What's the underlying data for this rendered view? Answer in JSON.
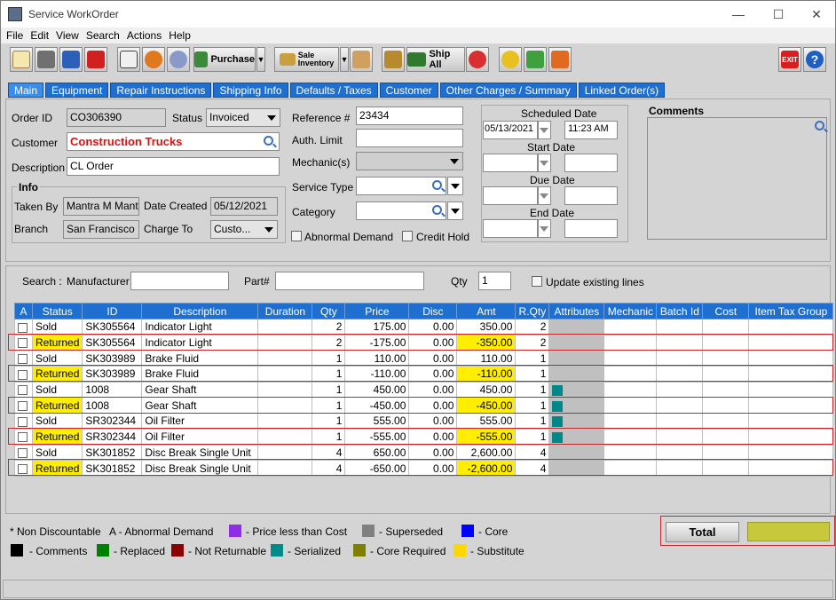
{
  "window": {
    "title": "Service WorkOrder"
  },
  "menu": [
    "File",
    "Edit",
    "View",
    "Search",
    "Actions",
    "Help"
  ],
  "toolbar": {
    "purchase": "Purchase",
    "sale_inventory": "Sale\nInventory",
    "ship_all": "Ship All",
    "icons": [
      "new-icon",
      "print-icon",
      "save-icon",
      "delete-icon",
      "notes-icon",
      "refresh-icon",
      "settings-icon",
      "purchase-icon",
      "sale-inventory-icon",
      "edit-icon",
      "ship-icon",
      "ship-all-icon",
      "apple-icon",
      "service-icon",
      "add-mechanic-icon",
      "tools-icon",
      "exit-icon",
      "help-icon"
    ]
  },
  "tabs": [
    "Main",
    "Equipment",
    "Repair Instructions",
    "Shipping Info",
    "Defaults / Taxes",
    "Customer",
    "Other Charges / Summary",
    "Linked Order(s)"
  ],
  "header": {
    "order_id_label": "Order ID",
    "order_id": "CO306390",
    "status_label": "Status",
    "status": "Invoiced",
    "customer_label": "Customer",
    "customer": "Construction Trucks",
    "description_label": "Description",
    "description": "CL Order",
    "info_label": "Info",
    "taken_by_label": "Taken By",
    "taken_by": "Mantra M Mantra",
    "date_created_label": "Date Created",
    "date_created": "05/12/2021",
    "branch_label": "Branch",
    "branch": "San Francisco",
    "charge_to_label": "Charge To",
    "charge_to": "Custo...",
    "reference_label": "Reference #",
    "reference": "23434",
    "auth_limit_label": "Auth. Limit",
    "auth_limit": "",
    "mechanics_label": "Mechanic(s)",
    "service_type_label": "Service Type",
    "category_label": "Category",
    "abnormal_demand_label": "Abnormal Demand",
    "credit_hold_label": "Credit Hold",
    "scheduled_date_label": "Scheduled Date",
    "scheduled_date": "05/13/2021",
    "scheduled_time": "11:23 AM",
    "start_date_label": "Start Date",
    "due_date_label": "Due Date",
    "end_date_label": "End Date",
    "comments_label": "Comments"
  },
  "search": {
    "label": "Search :",
    "manufacturer_label": "Manufacturer",
    "part_label": "Part#",
    "qty_label": "Qty",
    "qty": "1",
    "update_label": "Update existing lines"
  },
  "columns": [
    "A",
    "Status",
    "ID",
    "Description",
    "Duration",
    "Qty",
    "Price",
    "Disc",
    "Amt",
    "R.Qty",
    "Attributes",
    "Mechanic",
    "Batch Id",
    "Cost",
    "Item Tax Group"
  ],
  "rows": [
    {
      "status": "Sold",
      "id": "SK305564",
      "description": "Indicator Light",
      "qty": "2",
      "price": "175.00",
      "disc": "0.00",
      "amt": "350.00",
      "rqty": "2",
      "attr": false,
      "returned": false
    },
    {
      "status": "Returned",
      "id": "SK305564",
      "description": "Indicator Light",
      "qty": "2",
      "price": "-175.00",
      "disc": "0.00",
      "amt": "-350.00",
      "rqty": "2",
      "attr": false,
      "returned": true
    },
    {
      "status": "Sold",
      "id": "SK303989",
      "description": "Brake Fluid",
      "qty": "1",
      "price": "110.00",
      "disc": "0.00",
      "amt": "110.00",
      "rqty": "1",
      "attr": false,
      "returned": false
    },
    {
      "status": "Returned",
      "id": "SK303989",
      "description": "Brake Fluid",
      "qty": "1",
      "price": "-110.00",
      "disc": "0.00",
      "amt": "-110.00",
      "rqty": "1",
      "attr": false,
      "returned": true
    },
    {
      "status": "Sold",
      "id": "1008",
      "description": "Gear Shaft",
      "qty": "1",
      "price": "450.00",
      "disc": "0.00",
      "amt": "450.00",
      "rqty": "1",
      "attr": true,
      "returned": false
    },
    {
      "status": "Returned",
      "id": "1008",
      "description": "Gear Shaft",
      "qty": "1",
      "price": "-450.00",
      "disc": "0.00",
      "amt": "-450.00",
      "rqty": "1",
      "attr": true,
      "returned": true
    },
    {
      "status": "Sold",
      "id": "SR302344",
      "description": "Oil Filter",
      "qty": "1",
      "price": "555.00",
      "disc": "0.00",
      "amt": "555.00",
      "rqty": "1",
      "attr": true,
      "returned": false
    },
    {
      "status": "Returned",
      "id": "SR302344",
      "description": "Oil Filter",
      "qty": "1",
      "price": "-555.00",
      "disc": "0.00",
      "amt": "-555.00",
      "rqty": "1",
      "attr": true,
      "returned": true
    },
    {
      "status": "Sold",
      "id": "SK301852",
      "description": "Disc Break Single Unit",
      "qty": "4",
      "price": "650.00",
      "disc": "0.00",
      "amt": "2,600.00",
      "rqty": "4",
      "attr": false,
      "returned": false
    },
    {
      "status": "Returned",
      "id": "SK301852",
      "description": "Disc Break Single Unit",
      "qty": "4",
      "price": "-650.00",
      "disc": "0.00",
      "amt": "-2,600.00",
      "rqty": "4",
      "attr": false,
      "returned": true
    }
  ],
  "legend": {
    "non_discountable": "* Non Discountable",
    "abnormal_demand": "A - Abnormal Demand",
    "price_less_than_cost": "- Price less than Cost",
    "superseded": "- Superseded",
    "core": "- Core",
    "comments": "- Comments",
    "replaced": "- Replaced",
    "not_returnable": "- Not Returnable",
    "serialized": "- Serialized",
    "core_required": "- Core Required",
    "substitute": "- Substitute"
  },
  "colors": {
    "price_less_than_cost": "#8e2ee6",
    "superseded": "#808080",
    "core": "#0000ff",
    "comments": "#000000",
    "replaced": "#008000",
    "not_returnable": "#8b0000",
    "serialized": "#008b8b",
    "core_required": "#808000",
    "substitute": "#ffd700"
  },
  "total": {
    "label": "Total",
    "value": ""
  }
}
